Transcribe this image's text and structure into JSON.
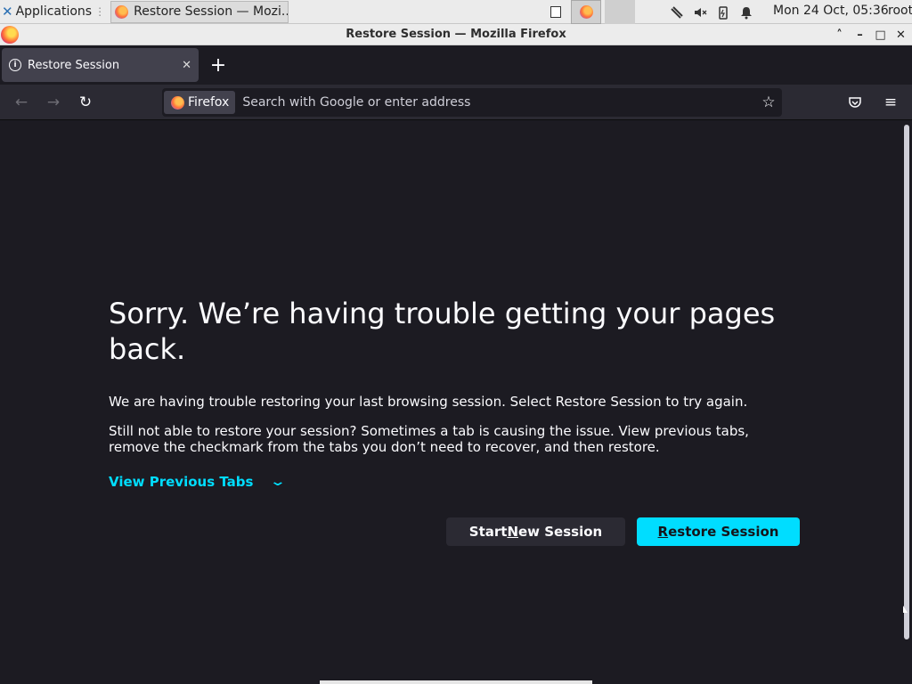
{
  "taskbar": {
    "apps_label": "Applications",
    "apps_sep": "⋮",
    "task_title": "Restore Session — Mozi...",
    "clock": "Mon 24 Oct, 05:36",
    "user": "root"
  },
  "window": {
    "title": "Restore Session — Mozilla Firefox",
    "btn_shade": "˄",
    "btn_min": "–",
    "btn_max": "□",
    "btn_close": "✕"
  },
  "tab": {
    "title": "Restore Session",
    "close": "✕",
    "new_tab": "+"
  },
  "navbar": {
    "back": "←",
    "forward": "→",
    "reload": "↻",
    "identity_label": "Firefox",
    "url_placeholder": "Search with Google or enter address",
    "star": "☆",
    "pocket": "♡",
    "menu": "≡"
  },
  "page": {
    "heading": "Sorry. We’re having trouble getting your pages back.",
    "p1": "We are having trouble restoring your last browsing session. Select Restore Session to try again.",
    "p2": "Still not able to restore your session? Sometimes a tab is causing the issue. View previous tabs, remove the checkmark from the tabs you don’t need to recover, and then restore.",
    "view_tabs": "View Previous Tabs",
    "start_new_pre": "Start ",
    "start_new_key": "N",
    "start_new_post": "ew Session",
    "restore_key": "R",
    "restore_post": "estore Session"
  },
  "colors": {
    "accent": "#00ddff",
    "background": "#1c1b22",
    "toolbar": "#2b2a33"
  }
}
